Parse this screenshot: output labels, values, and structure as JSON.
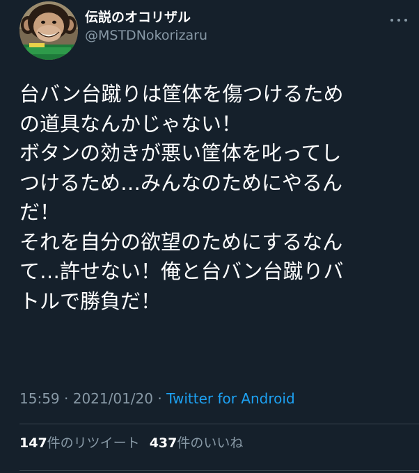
{
  "tweet": {
    "display_name": "伝説のオコリザル",
    "handle": "@MSTDNokorizaru",
    "text_lines": [
      "台バン台蹴りは筐体を傷つけるため",
      "の道具なんかじゃない！",
      "ボタンの効きが悪い筐体を叱ってし",
      "つけるため…みんなのためにやるん",
      "だ！",
      "それを自分の欲望のためにするなん",
      "て…許せない！俺と台バン台蹴りバ",
      "トルで勝負だ！"
    ],
    "time": "15:59",
    "separator": " · ",
    "date": "2021/01/20",
    "source": "Twitter for Android",
    "retweet_count": "147",
    "retweet_label": "件のリツイート",
    "like_count": "437",
    "like_label": "件のいいね"
  },
  "icons": {
    "more": "more-options-icon",
    "avatar": "chimpanzee-avatar"
  },
  "colors": {
    "background": "#15202b",
    "primary_text": "#ffffff",
    "secondary_text": "#8899a6",
    "link": "#1da1f2",
    "divider": "#38444d"
  }
}
